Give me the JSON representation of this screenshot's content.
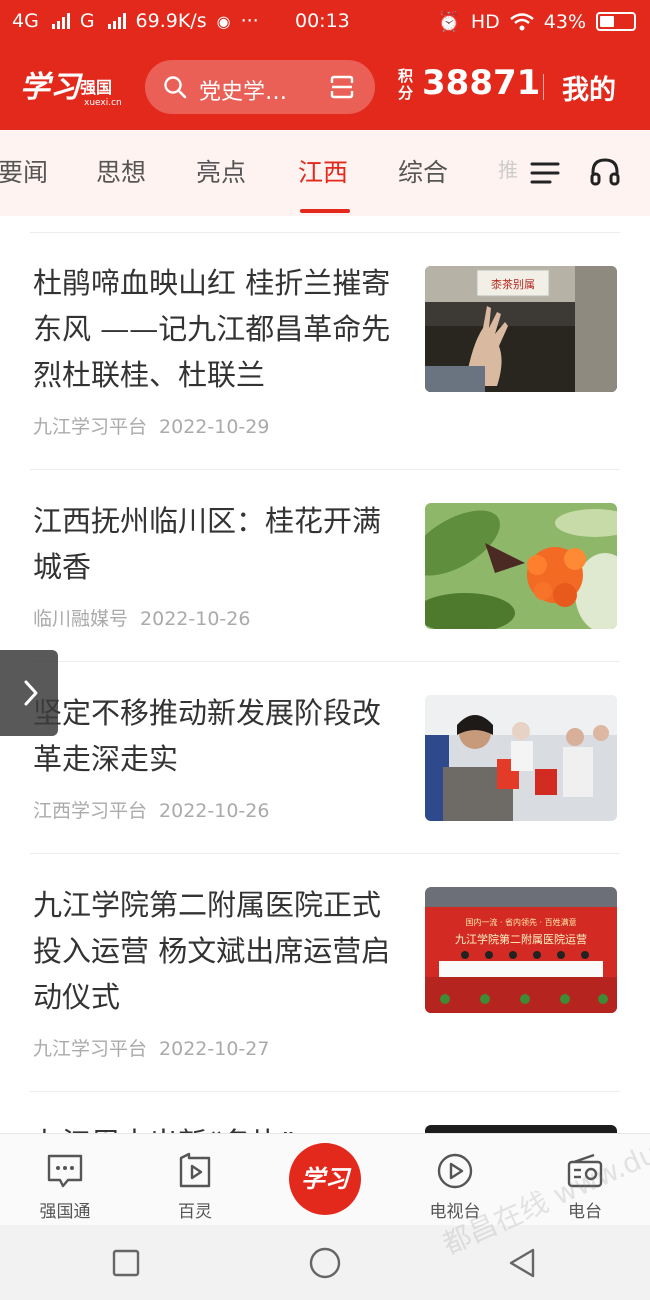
{
  "status_bar": {
    "network_4g": "4G",
    "network_g": "G",
    "speed": "69.9K/s",
    "more": "···",
    "time": "00:13",
    "hd": "HD",
    "battery": "43%"
  },
  "header": {
    "logo_text": "学习",
    "logo_sub": "强国",
    "logo_domain": "xuexi.cn",
    "search_text": "党史学…",
    "score_label": "积分",
    "score_value": "38871",
    "mine_label": "我的"
  },
  "tabs": [
    {
      "label": "要闻",
      "active": false
    },
    {
      "label": "思想",
      "active": false
    },
    {
      "label": "亮点",
      "active": false
    },
    {
      "label": "江西",
      "active": true
    },
    {
      "label": "综合",
      "active": false
    }
  ],
  "tab_overflow": "推",
  "colors": {
    "brand_red": "#e3291c",
    "tab_bg": "#fff3f1"
  },
  "feed": [
    {
      "title": "杜鹃啼血映山红 桂折兰摧寄东风 ——记九江都昌革命先烈杜联桂、杜联兰",
      "source": "九江学习平台",
      "date": "2022-10-29",
      "thumb_sign": "桼茶别属"
    },
    {
      "title": "江西抚州临川区：桂花开满城香",
      "source": "临川融媒号",
      "date": "2022-10-26"
    },
    {
      "title": "坚定不移推动新发展阶段改革走深走实",
      "source": "江西学习平台",
      "date": "2022-10-26"
    },
    {
      "title": "九江学院第二附属医院正式投入运营 杨文斌出席运营启动仪式",
      "source": "九江学习平台",
      "date": "2022-10-27",
      "thumb_banner_1": "国内一流 · 省内领先 · 百姓满意",
      "thumb_banner_2": "九江学院第二附属医院运营"
    },
    {
      "title": "九江周末出新“名片”",
      "source": "",
      "date": ""
    }
  ],
  "bottom_nav": [
    {
      "label": "强国通",
      "icon": "chat-icon"
    },
    {
      "label": "百灵",
      "icon": "play-square-icon"
    },
    {
      "label": "学习",
      "icon": "xuexi-logo"
    },
    {
      "label": "电视台",
      "icon": "play-circle-icon"
    },
    {
      "label": "电台",
      "icon": "radio-icon"
    }
  ],
  "watermark": "都昌在线 www.duchang"
}
